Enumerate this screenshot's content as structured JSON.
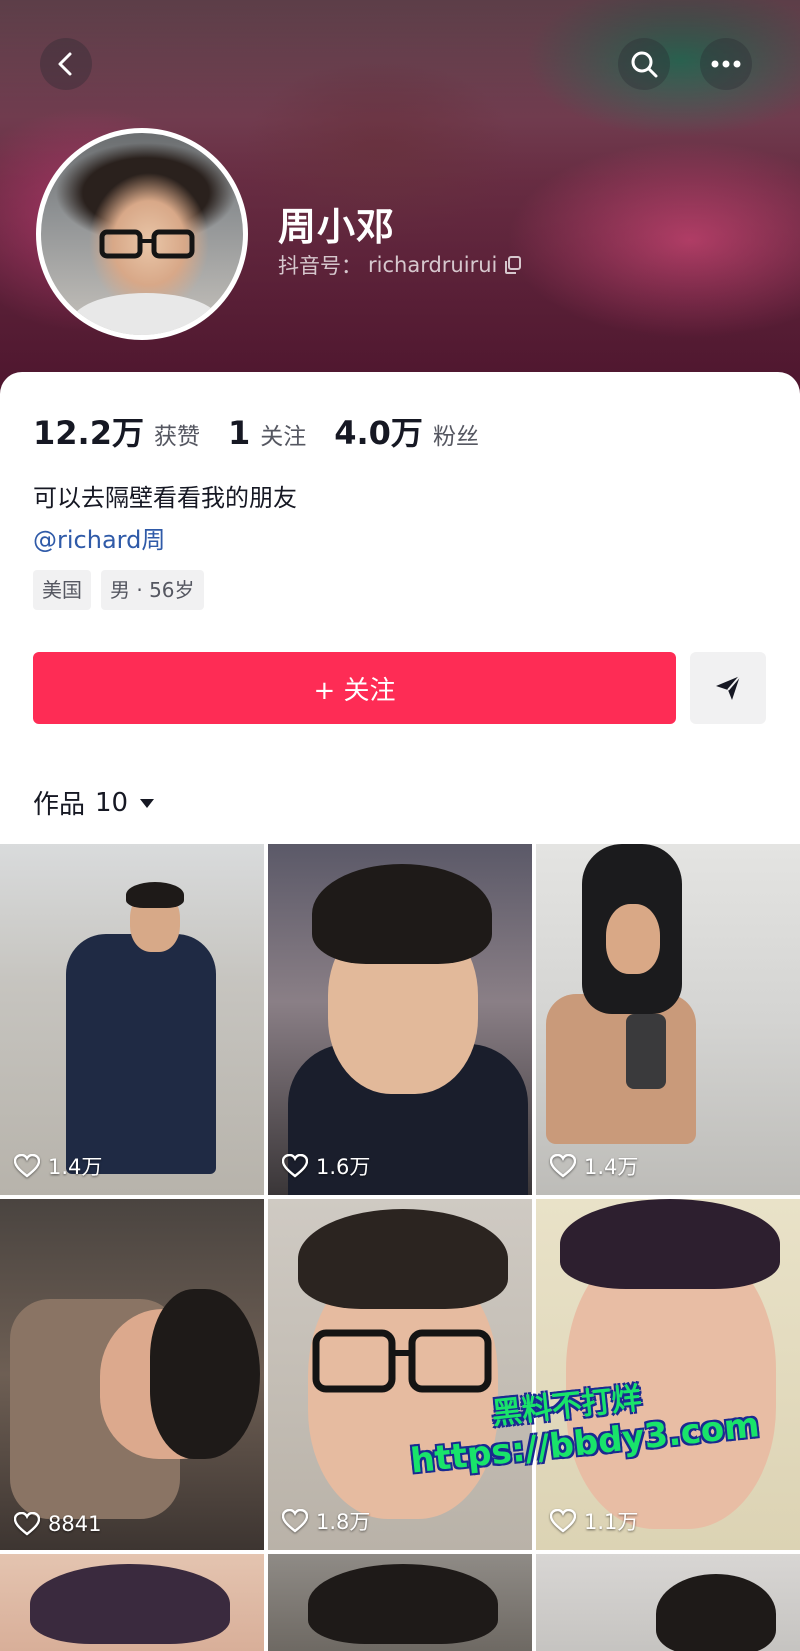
{
  "header": {
    "username": "周小邓",
    "douyin_id_label": "抖音号：",
    "douyin_id": "richardruirui"
  },
  "stats": [
    {
      "value": "12.2万",
      "label": "获赞"
    },
    {
      "value": "1",
      "label": "关注"
    },
    {
      "value": "4.0万",
      "label": "粉丝"
    }
  ],
  "bio": {
    "text": "可以去隔壁看看我的朋友",
    "mention": "@richard周"
  },
  "tags": [
    "美国",
    "男 · 56岁"
  ],
  "actions": {
    "follow_label": "+ 关注"
  },
  "works": {
    "label": "作品",
    "count": "10"
  },
  "videos": [
    {
      "likes": "1.4万"
    },
    {
      "likes": "1.6万"
    },
    {
      "likes": "1.4万"
    },
    {
      "likes": "8841"
    },
    {
      "likes": "1.8万"
    },
    {
      "likes": "1.1万"
    }
  ],
  "watermark": {
    "line1": "黑料不打烊",
    "line2": "https://bbdy3.com"
  },
  "colors": {
    "accent": "#fe2c55",
    "link": "#2f5aa8",
    "watermark": "#19e36a"
  },
  "icons": [
    "back-icon",
    "search-icon",
    "more-icon",
    "copy-icon",
    "share-icon",
    "dropdown-icon",
    "heart-icon"
  ]
}
